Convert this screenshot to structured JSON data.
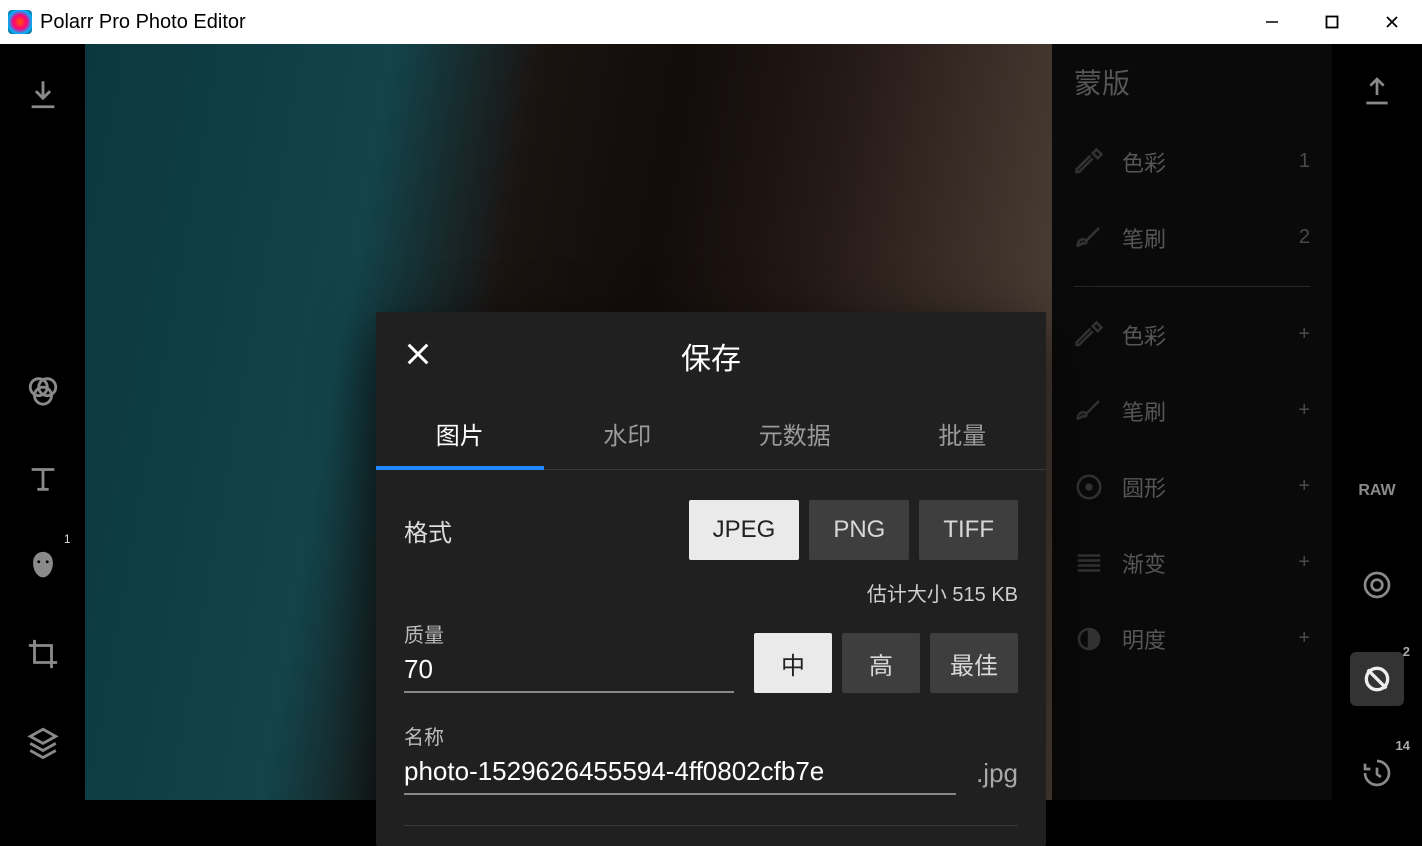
{
  "window": {
    "title": "Polarr Pro Photo Editor"
  },
  "left_tools": {
    "download": "download",
    "filters": "filters",
    "text": "text",
    "face": "face",
    "face_badge": "1",
    "crop": "crop",
    "layers": "layers"
  },
  "mask_panel": {
    "title": "蒙版",
    "items": [
      {
        "icon": "eyedropper",
        "label": "色彩",
        "suffix": "1"
      },
      {
        "icon": "brush",
        "label": "笔刷",
        "suffix": "2"
      },
      {
        "icon": "eyedropper",
        "label": "色彩",
        "suffix": "+"
      },
      {
        "icon": "brush",
        "label": "笔刷",
        "suffix": "+"
      },
      {
        "icon": "circle",
        "label": "圆形",
        "suffix": "+"
      },
      {
        "icon": "gradient",
        "label": "渐变",
        "suffix": "+"
      },
      {
        "icon": "luminance",
        "label": "明度",
        "suffix": "+"
      }
    ]
  },
  "right_tools": {
    "export": "export",
    "raw_label": "RAW",
    "swirl": "swirl",
    "denoise": "denoise",
    "denoise_badge": "2",
    "history": "history",
    "history_badge": "14"
  },
  "save_modal": {
    "title": "保存",
    "tabs": {
      "image": "图片",
      "watermark": "水印",
      "metadata": "元数据",
      "batch": "批量"
    },
    "active_tab": "image",
    "format_label": "格式",
    "formats": {
      "jpeg": "JPEG",
      "png": "PNG",
      "tiff": "TIFF"
    },
    "selected_format": "jpeg",
    "size_estimate_label": "估计大小",
    "size_estimate_value": "515 KB",
    "quality_label": "质量",
    "quality_value": "70",
    "quality_presets": {
      "mid": "中",
      "high": "高",
      "best": "最佳"
    },
    "selected_quality": "mid",
    "name_label": "名称",
    "name_value": "photo-1529626455594-4ff0802cfb7e",
    "ext": ".jpg"
  }
}
